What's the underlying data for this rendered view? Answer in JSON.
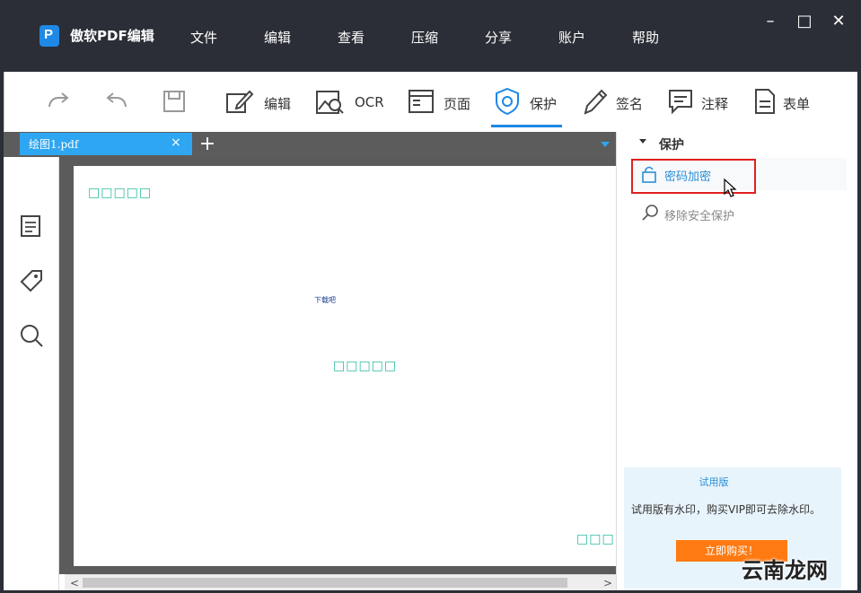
{
  "app": {
    "title": "傲软PDF编辑"
  },
  "menu": [
    "文件",
    "编辑",
    "查看",
    "压缩",
    "分享",
    "账户",
    "帮助"
  ],
  "window_controls": {
    "minimize": "–",
    "maximize": "□",
    "close": "✕"
  },
  "toolbar": {
    "edit": "编辑",
    "ocr": "OCR",
    "page": "页面",
    "protect": "保护",
    "sign": "签名",
    "annotate": "注释",
    "form": "表单",
    "active_tab": "保护"
  },
  "document_tab": {
    "name": "绘图1.pdf",
    "close": "×",
    "add": "+"
  },
  "document": {
    "watermark_placeholder": "□□□□□",
    "watermark_small": "下载吧",
    "watermark_partial": "□□□"
  },
  "scrollbar": {
    "left": "<",
    "right": ">"
  },
  "right_panel": {
    "section_title": "保护",
    "options": [
      {
        "label": "密码加密",
        "icon": "lock-icon",
        "selected": true
      },
      {
        "label": "移除安全保护",
        "icon": "search-icon",
        "selected": false
      }
    ]
  },
  "trial": {
    "title": "试用版",
    "message": "试用版有水印，购买VIP即可去除水印。",
    "button": "立即购买！"
  },
  "site_watermark": "云南龙网",
  "colors": {
    "titlebar": "#2b2e36",
    "accent": "#1e88e5",
    "tab": "#2fa6f2",
    "watermark": "#2bbba0",
    "buy_button": "#ff7a12",
    "highlight": "#e02020"
  }
}
